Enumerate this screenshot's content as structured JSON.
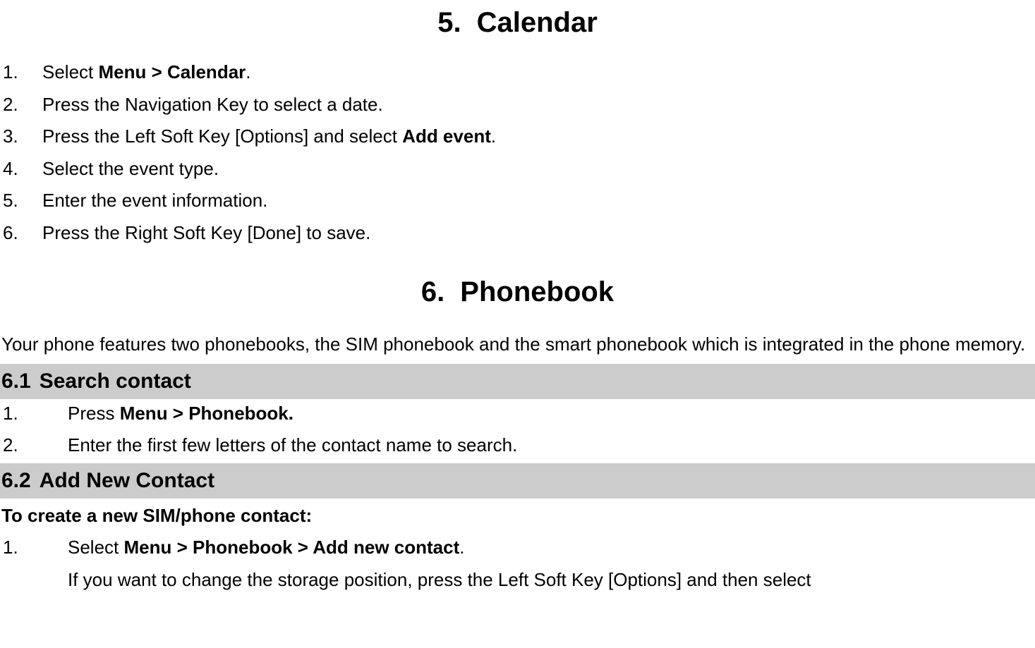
{
  "section5": {
    "num": "5.",
    "title": "Calendar",
    "steps": [
      {
        "n": "1.",
        "before": "Select ",
        "bold": "Menu > Calendar",
        "after": "."
      },
      {
        "n": "2.",
        "text": "Press the Navigation Key to select a date."
      },
      {
        "n": "3.",
        "before": "Press the Left Soft Key [Options] and select ",
        "bold": "Add event",
        "after": "."
      },
      {
        "n": "4.",
        "text": "Select the event type."
      },
      {
        "n": "5.",
        "text": "Enter the event information."
      },
      {
        "n": "6.",
        "text": "Press the Right Soft Key [Done] to save."
      }
    ]
  },
  "section6": {
    "num": "6.",
    "title": "Phonebook",
    "intro": "Your phone features two phonebooks, the SIM phonebook and the smart phonebook which is integrated in the phone memory.",
    "sub1": {
      "num": "6.1",
      "title": "Search contact",
      "steps": [
        {
          "n": "1.",
          "before": "Press ",
          "bold": "Menu > Phonebook."
        },
        {
          "n": "2.",
          "text": "Enter the first few letters of the contact name to search."
        }
      ]
    },
    "sub2": {
      "num": "6.2",
      "title": "Add New Contact",
      "lead": "To create a new SIM/phone contact:",
      "steps": [
        {
          "n": "1.",
          "before": "Select ",
          "bold": "Menu > Phonebook > Add new contact",
          "after": "."
        }
      ],
      "follow": "If you want to change the storage position, press the Left Soft Key [Options] and then select"
    }
  }
}
